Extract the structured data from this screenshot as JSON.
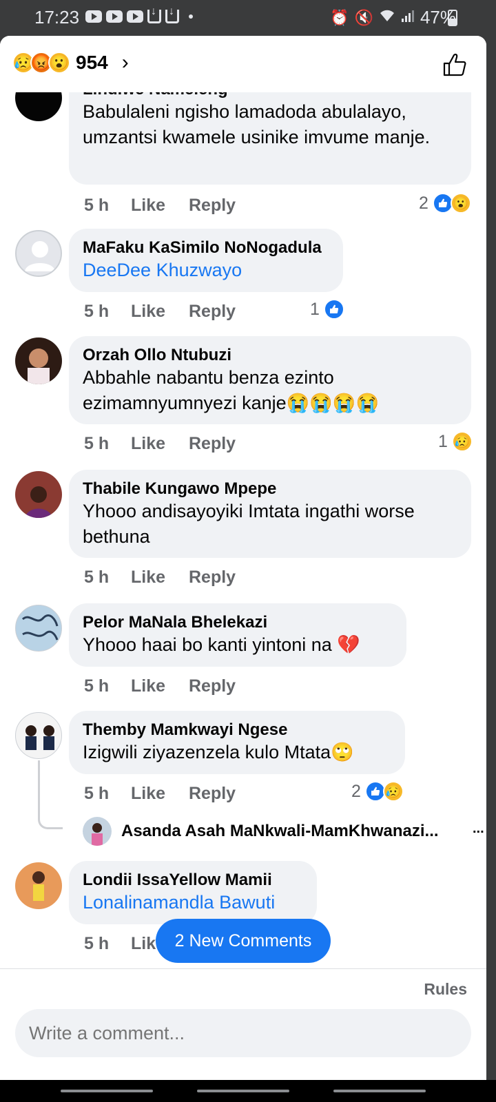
{
  "status_bar": {
    "time": "17:23",
    "battery": "47%",
    "battery_level": 0.47
  },
  "header": {
    "reaction_count": "954",
    "reaction_icons": [
      "sad-face-icon",
      "angry-face-icon",
      "wow-face-icon"
    ]
  },
  "comments": [
    {
      "author": "Lindiwe Nameleng",
      "text": "Babulaleni ngisho lamadoda abulalayo, umzantsi kwamele usinike imvume manje.",
      "time": "5 h",
      "reaction_count": "2",
      "reactions": [
        "like-icon",
        "wow-icon"
      ]
    },
    {
      "author": "MaFaku KaSimilo NoNogadula",
      "link": "DeeDee Khuzwayo",
      "time": "5 h",
      "reaction_count": "1",
      "reactions": [
        "like-icon"
      ]
    },
    {
      "author": "Orzah Ollo Ntubuzi",
      "text": "Abbahle nabantu benza ezinto ezimamnyumnyezi kanje😭😭😭😭",
      "time": "5 h",
      "reaction_count": "1",
      "reactions": [
        "sad-icon"
      ]
    },
    {
      "author": "Thabile Kungawo Mpepe",
      "text": "Yhooo andisayoyiki Imtata ingathi worse bethuna",
      "time": "5 h"
    },
    {
      "author": "Pelor MaNala Bhelekazi",
      "text": "Yhooo haai bo kanti yintoni na 💔",
      "time": "5 h"
    },
    {
      "author": "Themby Mamkwayi Ngese",
      "text": "Izigwili ziyazenzela kulo Mtata🙄",
      "time": "5 h",
      "reaction_count": "2",
      "reactions": [
        "like-icon",
        "sad-icon"
      ],
      "reply_preview": "Asanda Asah MaNkwali-MamKhwanazi...",
      "reply_more": "..."
    },
    {
      "author": "Londii IssaYellow Mamii",
      "link": "Lonalinamandla Bawuti",
      "time": "5 h"
    }
  ],
  "actions": {
    "like": "Like",
    "reply": "Reply",
    "like_truncated": "Lik"
  },
  "new_comments_button": "2 New Comments",
  "footer": {
    "rules": "Rules",
    "input_placeholder": "Write a comment..."
  },
  "colors": {
    "accent": "#1877f2",
    "bubble": "#f0f2f5",
    "secondary_text": "#65676b"
  }
}
